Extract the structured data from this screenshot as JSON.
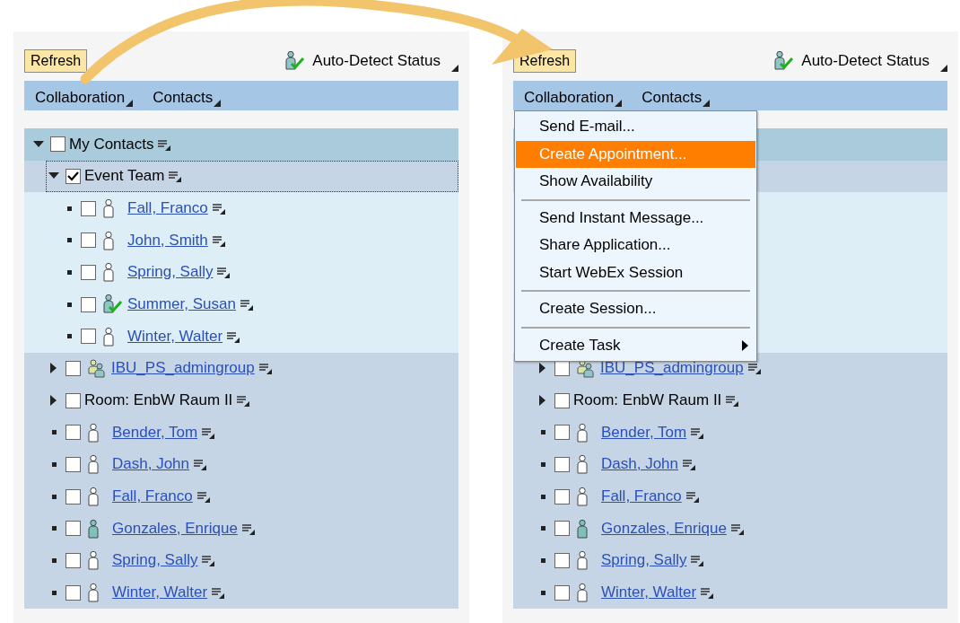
{
  "panels": [
    {
      "refresh": "Refresh",
      "status": "Auto-Detect Status",
      "menus": [
        "Collaboration",
        "Contacts"
      ],
      "tree": [
        {
          "kind": "root",
          "label": "My Contacts",
          "checked": false,
          "expanded": true,
          "selected": false,
          "children": [
            {
              "kind": "group",
              "label": "Event Team",
              "checked": true,
              "expanded": true,
              "selected": true,
              "children": [
                {
                  "kind": "contact",
                  "label": "Fall, Franco",
                  "checked": false,
                  "online": false,
                  "color": "#ffffff",
                  "selected": false
                },
                {
                  "kind": "contact",
                  "label": "John, Smith",
                  "checked": false,
                  "online": false,
                  "color": "#ffffff",
                  "selected": false
                },
                {
                  "kind": "contact",
                  "label": "Spring, Sally",
                  "checked": false,
                  "online": false,
                  "color": "#ffffff",
                  "selected": false
                },
                {
                  "kind": "contact",
                  "label": "Summer, Susan",
                  "checked": false,
                  "online": true,
                  "color": "#8fc6c9",
                  "selected": false
                },
                {
                  "kind": "contact",
                  "label": "Winter, Walter",
                  "checked": false,
                  "online": false,
                  "color": "#ffffff",
                  "selected": false
                }
              ]
            },
            {
              "kind": "team",
              "label": "IBU_PS_admingroup",
              "checked": false,
              "expanded": false,
              "selected": false
            },
            {
              "kind": "room",
              "label": "Room: EnbW Raum II",
              "checked": false,
              "expanded": false,
              "selected": false
            },
            {
              "kind": "contact",
              "label": "Bender, Tom",
              "checked": false,
              "online": false,
              "color": "#ffffff",
              "selected": false
            },
            {
              "kind": "contact",
              "label": "Dash, John",
              "checked": false,
              "online": false,
              "color": "#ffffff",
              "selected": false
            },
            {
              "kind": "contact",
              "label": "Fall, Franco",
              "checked": false,
              "online": false,
              "color": "#ffffff",
              "selected": false
            },
            {
              "kind": "contact",
              "label": "Gonzales, Enrique",
              "checked": false,
              "online": false,
              "color": "#7fc0bd",
              "selected": false
            },
            {
              "kind": "contact",
              "label": "Spring, Sally",
              "checked": false,
              "online": false,
              "color": "#ffffff",
              "selected": false
            },
            {
              "kind": "contact",
              "label": "Winter, Walter",
              "checked": false,
              "online": false,
              "color": "#ffffff",
              "selected": false
            }
          ]
        }
      ]
    },
    {
      "refresh": "Refresh",
      "status": "Auto-Detect Status",
      "menus": [
        "Collaboration",
        "Contacts"
      ],
      "dropdown": [
        [
          {
            "label": "Send E-mail...",
            "selected": false,
            "submenu": false
          },
          {
            "label": "Create Appointment...",
            "selected": true,
            "submenu": false
          },
          {
            "label": "Show Availability",
            "selected": false,
            "submenu": false
          }
        ],
        [
          {
            "label": "Send Instant Message...",
            "selected": false,
            "submenu": false
          },
          {
            "label": "Share Application...",
            "selected": false,
            "submenu": false
          },
          {
            "label": "Start WebEx Session",
            "selected": false,
            "submenu": false
          }
        ],
        [
          {
            "label": "Create Session...",
            "selected": false,
            "submenu": false
          }
        ],
        [
          {
            "label": "Create Task",
            "selected": false,
            "submenu": true
          }
        ]
      ],
      "tree": [
        {
          "kind": "team",
          "label": "IBU_PS_admingroup",
          "checked": false,
          "expanded": false,
          "selected": false
        },
        {
          "kind": "room",
          "label": "Room: EnbW Raum II",
          "checked": false,
          "expanded": false,
          "selected": false
        },
        {
          "kind": "contact",
          "label": "Bender, Tom",
          "checked": false,
          "online": false,
          "color": "#ffffff",
          "selected": false
        },
        {
          "kind": "contact",
          "label": "Dash, John",
          "checked": false,
          "online": false,
          "color": "#ffffff",
          "selected": false
        },
        {
          "kind": "contact",
          "label": "Fall, Franco",
          "checked": false,
          "online": false,
          "color": "#ffffff",
          "selected": false
        },
        {
          "kind": "contact",
          "label": "Gonzales, Enrique",
          "checked": false,
          "online": false,
          "color": "#7fc0bd",
          "selected": false
        },
        {
          "kind": "contact",
          "label": "Spring, Sally",
          "checked": false,
          "online": false,
          "color": "#ffffff",
          "selected": false
        },
        {
          "kind": "contact",
          "label": "Winter, Walter",
          "checked": false,
          "online": false,
          "color": "#ffffff",
          "selected": false
        }
      ]
    }
  ]
}
